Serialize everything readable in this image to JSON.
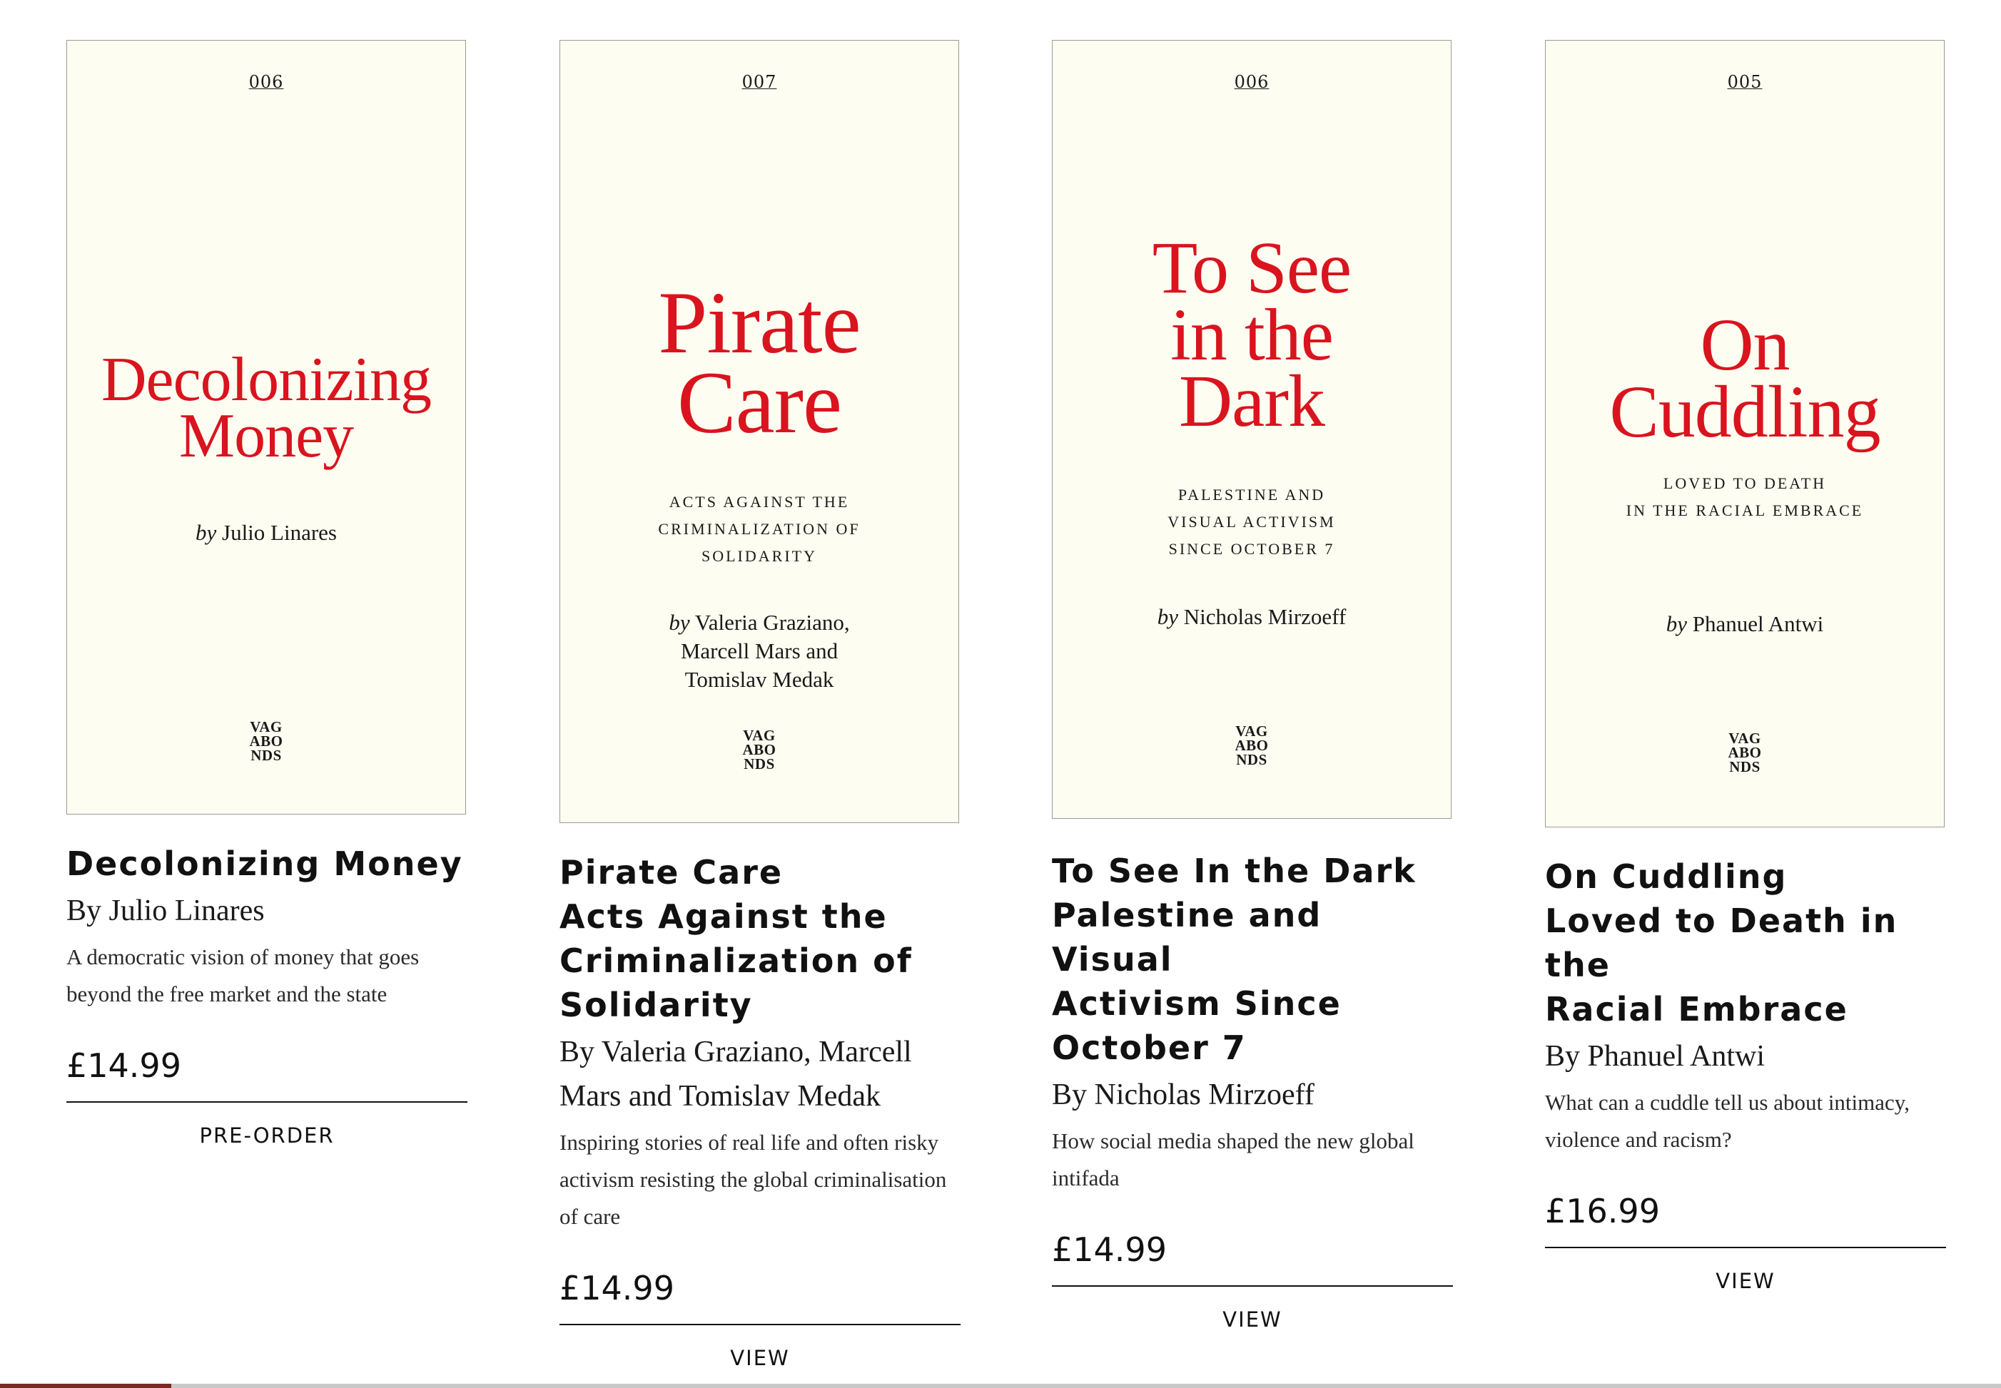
{
  "books": [
    {
      "cover": {
        "number": "006",
        "title_lines": [
          "Decolonizing",
          "Money"
        ],
        "subtitle_lines": [],
        "by_word": "by",
        "author_lines": [
          "Julio Linares"
        ],
        "logo_lines": [
          "VAG",
          "ABO",
          "NDS"
        ]
      },
      "title_lines": [
        "Decolonizing Money"
      ],
      "author": "By Julio Linares",
      "description": "A democratic vision of money that goes beyond the free market and the state",
      "price": "£14.99",
      "action": "PRE-ORDER"
    },
    {
      "cover": {
        "number": "007",
        "title_lines": [
          "Pirate",
          "Care"
        ],
        "subtitle_lines": [
          "ACTS AGAINST THE",
          "CRIMINALIZATION of",
          "SOLIDARITY"
        ],
        "by_word": "by",
        "author_lines": [
          "Valeria Graziano,",
          "Marcell Mars and",
          "Tomislav Medak"
        ],
        "logo_lines": [
          "VAG",
          "ABO",
          "NDS"
        ]
      },
      "title_lines": [
        "Pirate Care",
        "Acts Against the",
        "Criminalization of",
        "Solidarity"
      ],
      "author": "By Valeria Graziano, Marcell Mars and Tomislav Medak",
      "description": "Inspiring stories of real life and often risky activism resisting the global criminalisation of care",
      "price": "£14.99",
      "action": "VIEW"
    },
    {
      "cover": {
        "number": "006",
        "title_lines": [
          "To See",
          "in the",
          "Dark"
        ],
        "subtitle_lines": [
          "PALESTINE and",
          "VISUAL ACTIVISM",
          "SINCE OCTOBER 7"
        ],
        "by_word": "by",
        "author_lines": [
          "Nicholas Mirzoeff"
        ],
        "logo_lines": [
          "VAG",
          "ABO",
          "NDS"
        ]
      },
      "title_lines": [
        "To See In the Dark",
        "Palestine and Visual",
        "Activism Since",
        "October 7"
      ],
      "author": "By Nicholas Mirzoeff",
      "description": "How social media shaped the new global intifada",
      "price": "£14.99",
      "action": "VIEW"
    },
    {
      "cover": {
        "number": "005",
        "title_lines": [
          "On",
          "Cuddling"
        ],
        "subtitle_lines": [
          "LOVED TO DEATH",
          "in the RACIAL EMBRACE"
        ],
        "by_word": "by",
        "author_lines": [
          "Phanuel Antwi"
        ],
        "logo_lines": [
          "VAG",
          "ABO",
          "NDS"
        ]
      },
      "title_lines": [
        "On Cuddling",
        "Loved to Death in the",
        "Racial Embrace"
      ],
      "author": "By Phanuel Antwi",
      "description": "What can a cuddle tell us about intimacy, violence and racism?",
      "price": "£16.99",
      "action": "VIEW"
    }
  ],
  "colors": {
    "cover_background": "#fdfdf1",
    "cover_title": "#d9141e",
    "text": "#111111"
  }
}
